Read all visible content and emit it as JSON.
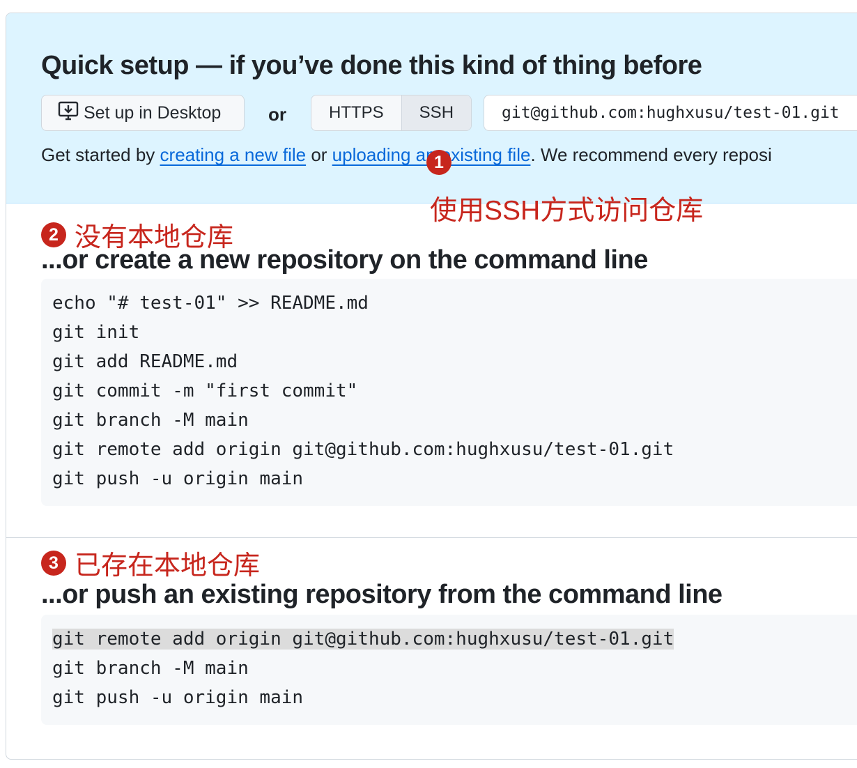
{
  "quick_setup": {
    "title": "Quick setup — if you’ve done this kind of thing before",
    "desktop_button": "Set up in Desktop",
    "or_label": "or",
    "protocols": [
      "HTTPS",
      "SSH"
    ],
    "selected_protocol": "SSH",
    "clone_url": "git@github.com:hughxusu/test-01.git",
    "get_started": {
      "prefix": "Get started by ",
      "link_create": "creating a new file",
      "middle": " or ",
      "link_upload": "uploading an existing file",
      "suffix": ". We recommend every reposi"
    }
  },
  "annotations": {
    "one": {
      "number": "1",
      "text": "使用SSH方式访问仓库"
    },
    "two": {
      "number": "2",
      "text": "没有本地仓库"
    },
    "three": {
      "number": "3",
      "text": "已存在本地仓库"
    }
  },
  "new_repo": {
    "title": "...or create a new repository on the command line",
    "lines": [
      "echo \"# test-01\" >> README.md",
      "git init",
      "git add README.md",
      "git commit -m \"first commit\"",
      "git branch -M main",
      "git remote add origin git@github.com:hughxusu/test-01.git",
      "git push -u origin main"
    ]
  },
  "push_existing": {
    "title": "...or push an existing repository from the command line",
    "lines": [
      "git remote add origin git@github.com:hughxusu/test-01.git",
      "git branch -M main",
      "git push -u origin main"
    ]
  },
  "colors": {
    "annotation": "#c7261d",
    "link": "#0969da",
    "quick_setup_bg": "#ddf4ff"
  }
}
